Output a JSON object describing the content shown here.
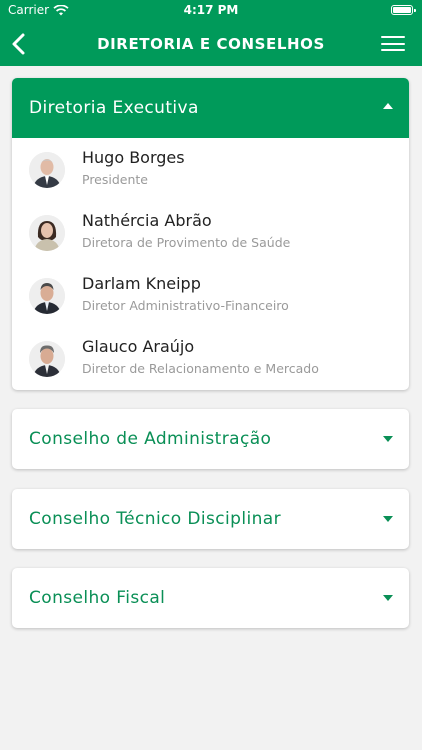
{
  "status": {
    "carrier": "Carrier",
    "time": "4:17 PM"
  },
  "header": {
    "title": "DIRETORIA E CONSELHOS",
    "back_icon": "chevron-left-icon",
    "menu_icon": "hamburger-menu-icon"
  },
  "colors": {
    "brand_green": "#009a5a",
    "accent_text": "#0a8f56",
    "background": "#f2f2f2"
  },
  "sections": [
    {
      "label": "Diretoria Executiva",
      "expanded": true,
      "members": [
        {
          "name": "Hugo Borges",
          "role": "Presidente"
        },
        {
          "name": "Nathércia Abrão",
          "role": "Diretora de Provimento de Saúde"
        },
        {
          "name": "Darlam Kneipp",
          "role": "Diretor Administrativo-Financeiro"
        },
        {
          "name": "Glauco Araújo",
          "role": "Diretor de Relacionamento e Mercado"
        }
      ]
    },
    {
      "label": "Conselho de Administração",
      "expanded": false
    },
    {
      "label": "Conselho Técnico Disciplinar",
      "expanded": false
    },
    {
      "label": "Conselho Fiscal",
      "expanded": false
    }
  ]
}
